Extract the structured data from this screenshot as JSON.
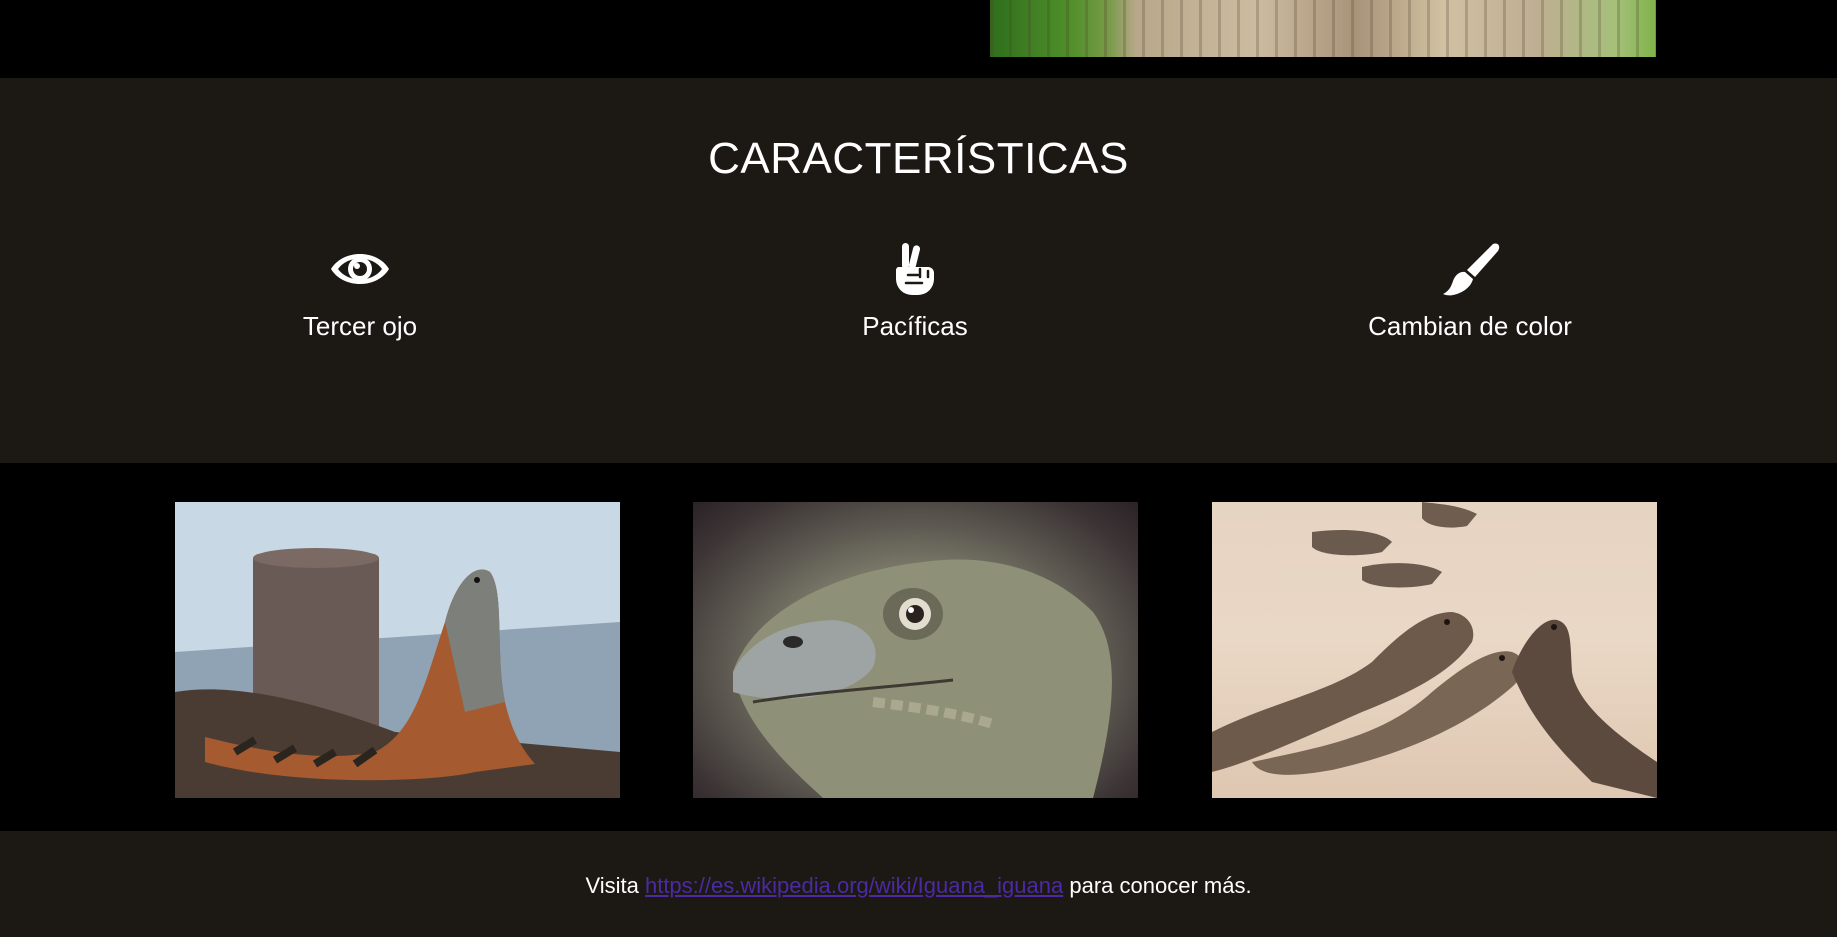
{
  "features": {
    "title": "CARACTERÍSTICAS",
    "items": [
      {
        "label": "Tercer ojo",
        "icon": "eye-icon"
      },
      {
        "label": "Pacíficas",
        "icon": "peace-hand-icon"
      },
      {
        "label": "Cambian de color",
        "icon": "paint-brush-icon"
      }
    ]
  },
  "footer": {
    "prefix": "Visita",
    "link_text": "https://es.wikipedia.org/wiki/Iguana_iguana",
    "suffix": "para conocer más."
  },
  "colors": {
    "section_bg": "#1c1814",
    "page_bg": "#000000",
    "text": "#ffffff",
    "link": "#4b2aa3"
  }
}
